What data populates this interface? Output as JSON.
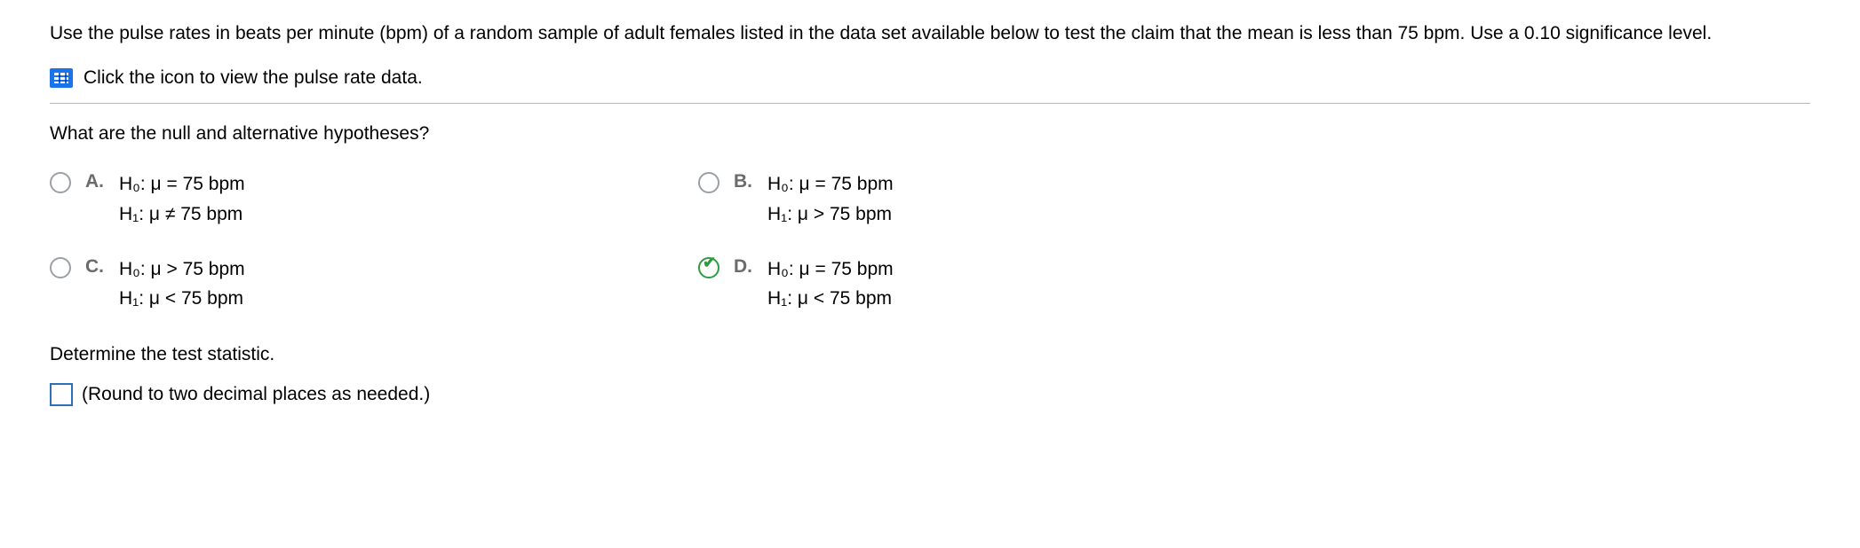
{
  "intro": "Use the pulse rates in beats per minute (bpm) of a random sample of adult females listed in the data set available below to test the claim that the mean is less than 75 bpm. Use a 0.10 significance level.",
  "dataLinkText": "Click the icon to view the pulse rate data.",
  "question1": "What are the null and alternative hypotheses?",
  "options": {
    "A": {
      "letter": "A.",
      "h0": "H₀: μ = 75 bpm",
      "h1": "H₁: μ ≠ 75 bpm",
      "correct": false
    },
    "B": {
      "letter": "B.",
      "h0": "H₀: μ = 75 bpm",
      "h1": "H₁: μ > 75 bpm",
      "correct": false
    },
    "C": {
      "letter": "C.",
      "h0": "H₀: μ > 75 bpm",
      "h1": "H₁: μ < 75 bpm",
      "correct": false
    },
    "D": {
      "letter": "D.",
      "h0": "H₀: μ = 75 bpm",
      "h1": "H₁: μ < 75 bpm",
      "correct": true
    }
  },
  "question2": "Determine the test statistic.",
  "answerHint": "(Round to two decimal places as needed.)"
}
